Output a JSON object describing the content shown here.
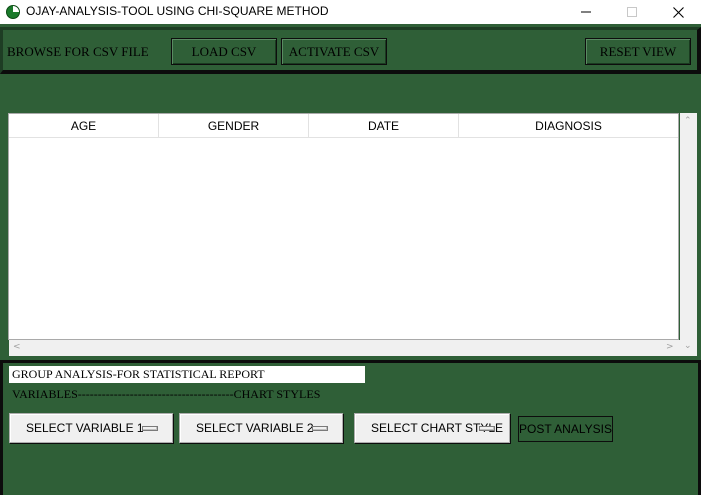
{
  "window": {
    "title": "OJAY-ANALYSIS-TOOL USING CHI-SQUARE METHOD",
    "icon": "app-pie-icon",
    "controls": {
      "minimize": "—",
      "maximize": "☐",
      "close": "✕"
    }
  },
  "toolbar": {
    "browse_label": "BROWSE FOR CSV FILE",
    "load_label": "LOAD CSV",
    "activate_label": "ACTIVATE CSV",
    "reset_label": "RESET VIEW"
  },
  "table": {
    "columns": [
      "AGE",
      "GENDER",
      "DATE",
      "DIAGNOSIS"
    ],
    "rows": []
  },
  "analysis": {
    "group_title": "GROUP ANALYSIS-FOR STATISTICAL REPORT",
    "section_labels": "VARIABLES---------------------------------------CHART STYLES",
    "select_variable_1": "SELECT VARIABLE 1",
    "select_variable_2": "SELECT VARIABLE 2",
    "select_chart_style": "SELECT CHART STYLE",
    "post_label": "POST ANALYSIS"
  },
  "colors": {
    "background": "#2f5f37",
    "panel_border": "#0c0c0c",
    "title_bar": "#ffffff"
  }
}
